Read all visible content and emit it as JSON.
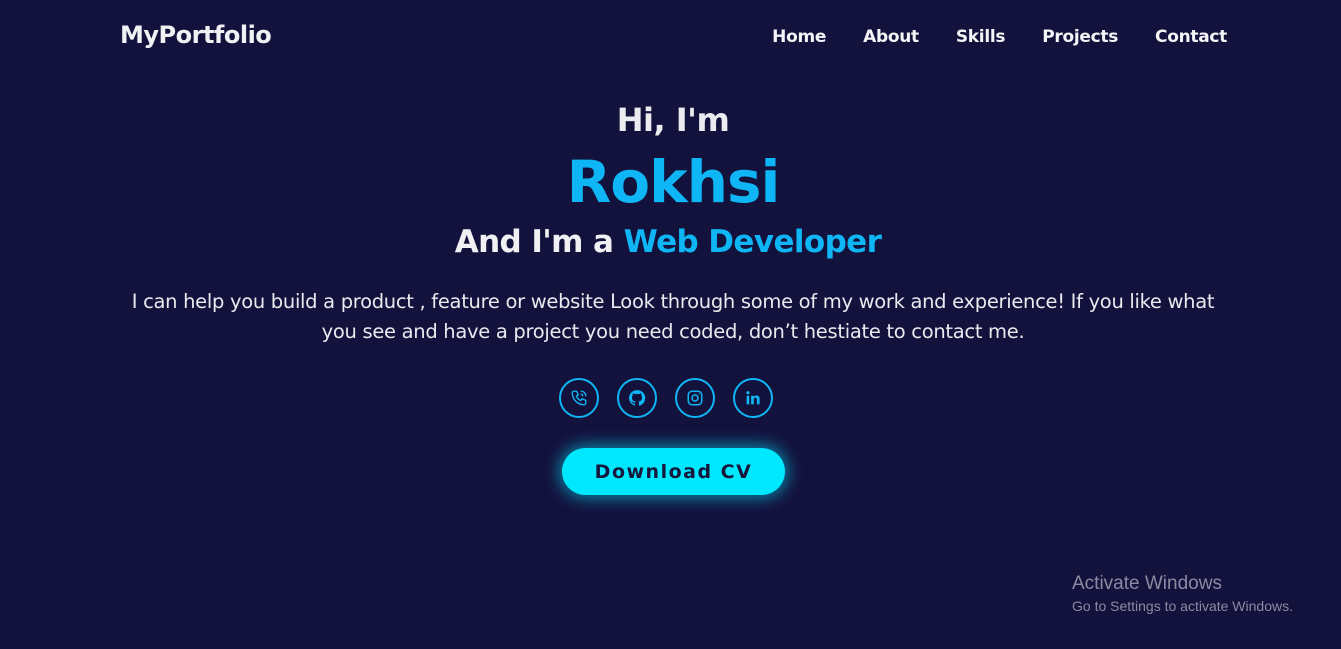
{
  "nav": {
    "logo": "MyPortfolio",
    "links": [
      "Home",
      "About",
      "Skills",
      "Projects",
      "Contact"
    ]
  },
  "hero": {
    "greeting": "Hi, I'm",
    "name": "Rokhsi",
    "role_prefix": "And I'm a",
    "role": "Web Developer",
    "description": "I can help you build a product , feature or website Look through some of my work and experience! If you like what you see and have a project you need coded, don’t hestiate to contact me."
  },
  "socials": [
    {
      "icon": "phone-icon"
    },
    {
      "icon": "github-icon"
    },
    {
      "icon": "instagram-icon"
    },
    {
      "icon": "linkedin-icon"
    }
  ],
  "cta": {
    "label": "Download CV"
  },
  "watermark": {
    "title": "Activate Windows",
    "subtitle": "Go to Settings to activate Windows."
  },
  "colors": {
    "background": "#13123d",
    "accent": "#0fb6f5",
    "button": "#00e8ff",
    "text": "#ffffff"
  }
}
